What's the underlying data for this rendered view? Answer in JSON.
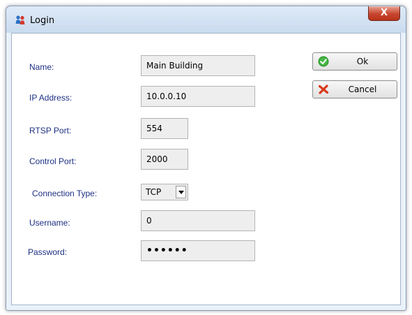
{
  "window": {
    "title": "Login",
    "close_symbol": "X",
    "icon": "network-people-icon"
  },
  "form": {
    "name": {
      "label": "Name:",
      "value": "Main Building"
    },
    "ip_address": {
      "label": "IP Address:",
      "value": "10.0.0.10"
    },
    "rtsp_port": {
      "label": "RTSP Port:",
      "value": "554"
    },
    "control_port": {
      "label": "Control Port:",
      "value": "2000"
    },
    "connection_type": {
      "label": "Connection Type:",
      "value": "TCP"
    },
    "username": {
      "label": "Username:",
      "value": "0"
    },
    "password": {
      "label": "Password:",
      "value": "••••••"
    }
  },
  "buttons": {
    "ok": {
      "label": "Ok",
      "icon": "check-circle-icon"
    },
    "cancel": {
      "label": "Cancel",
      "icon": "red-x-icon"
    }
  },
  "colors": {
    "label_text": "#1d2f83",
    "field_bg": "#eeeeee",
    "close_button": "#c7462d"
  }
}
